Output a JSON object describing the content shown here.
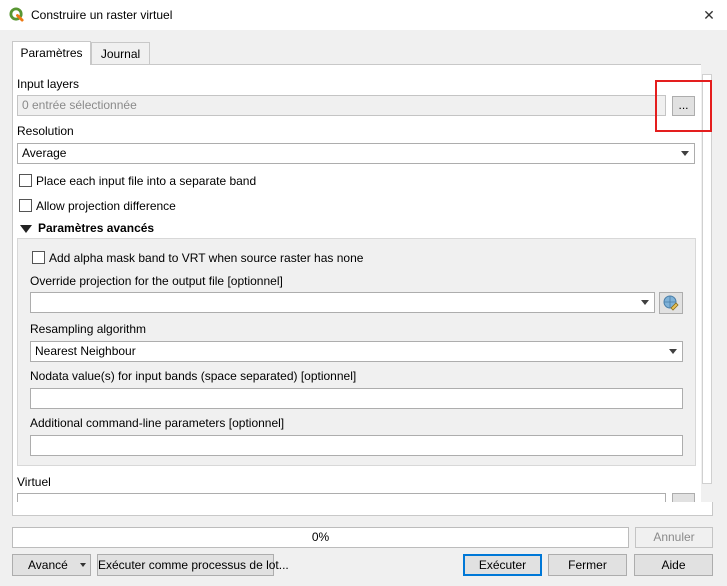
{
  "window": {
    "title": "Construire un raster virtuel",
    "close_glyph": "✕"
  },
  "tabs": [
    {
      "label": "Paramètres",
      "active": true
    },
    {
      "label": "Journal",
      "active": false
    }
  ],
  "params": {
    "input_layers": {
      "label": "Input layers",
      "value": "0 entrée sélectionnée",
      "browse_label": "..."
    },
    "resolution": {
      "label": "Resolution",
      "value": "Average"
    },
    "separate_band": {
      "label": "Place each input file into a separate band",
      "checked": false
    },
    "projection_difference": {
      "label": "Allow projection difference",
      "checked": false
    },
    "advanced": {
      "header": "Paramètres avancés",
      "alpha_mask": {
        "label": "Add alpha mask band to VRT when source raster has none",
        "checked": false
      },
      "override_projection": {
        "label": "Override projection for the output file [optionnel]",
        "value": ""
      },
      "resampling": {
        "label": "Resampling algorithm",
        "value": "Nearest Neighbour"
      },
      "nodata": {
        "label": "Nodata value(s) for input bands (space separated) [optionnel]",
        "value": ""
      },
      "extra_params": {
        "label": "Additional command-line parameters [optionnel]",
        "value": ""
      }
    },
    "virtual": {
      "label": "Virtuel"
    }
  },
  "progress": {
    "text": "0%",
    "value": 0
  },
  "buttons": {
    "cancel": "Annuler",
    "advanced": "Avancé",
    "batch": "Exécuter comme processus de lot...",
    "run": "Exécuter",
    "close": "Fermer",
    "help": "Aide"
  },
  "colors": {
    "highlight_box": "#e41e1e",
    "qgis_green": "#589632",
    "default_button_border": "#0078d7"
  }
}
